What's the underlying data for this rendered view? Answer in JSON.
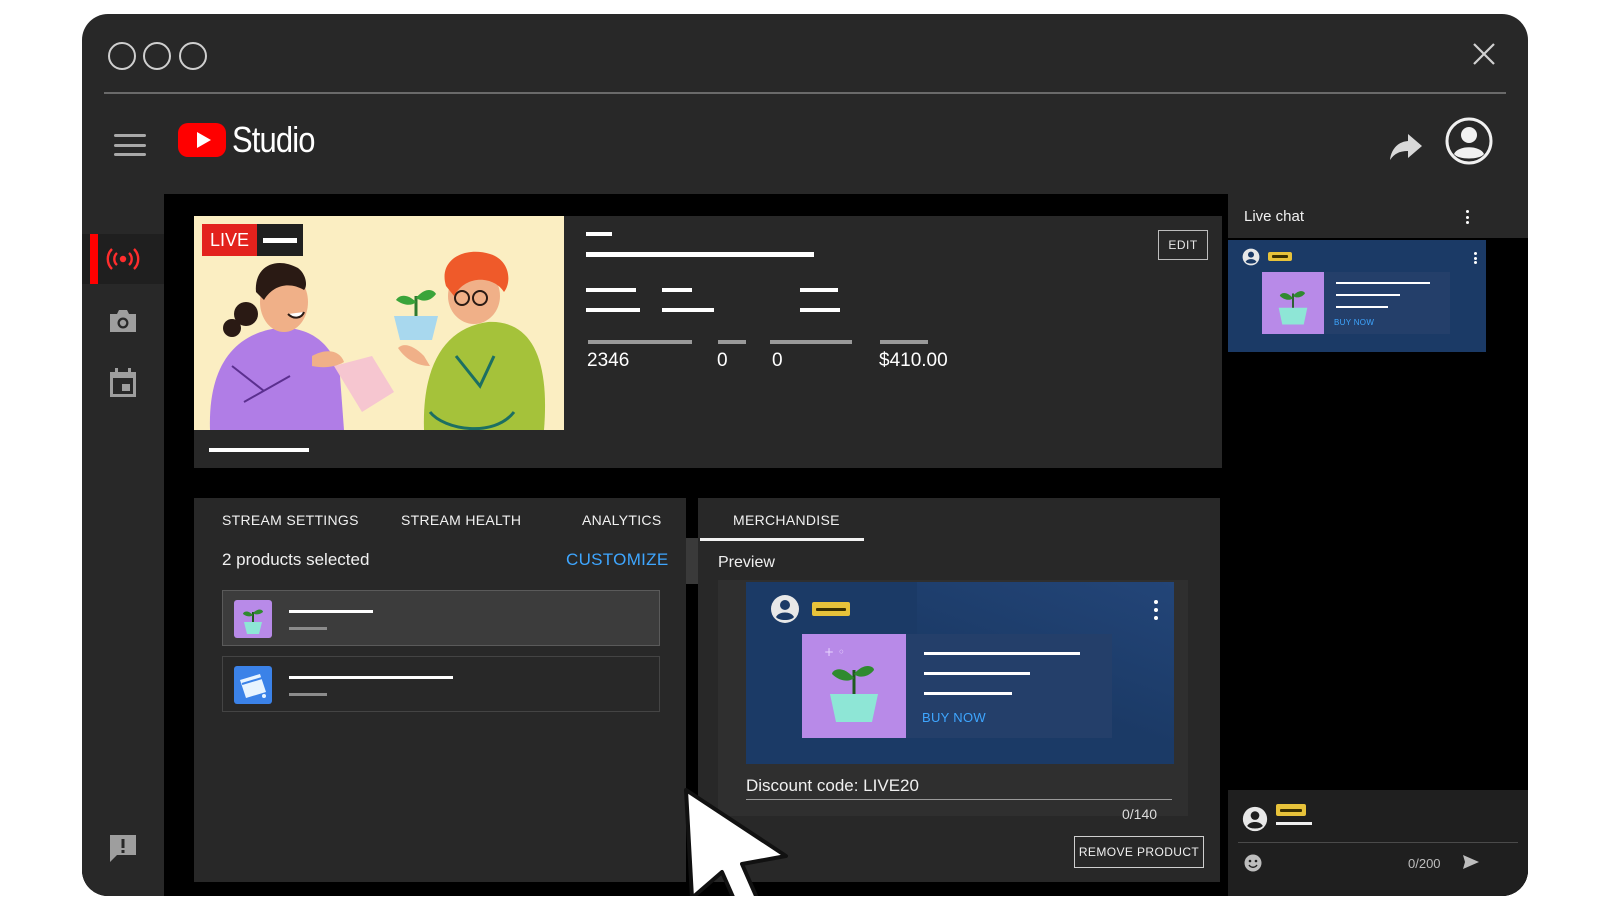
{
  "app": {
    "name": "Studio"
  },
  "stream": {
    "live_label": "LIVE",
    "edit_label": "EDIT",
    "stats": [
      "2346",
      "0",
      "0",
      "$410.00"
    ]
  },
  "tabs": [
    "STREAM SETTINGS",
    "STREAM HEALTH",
    "ANALYTICS",
    "MERCHANDISE"
  ],
  "active_tab": "MERCHANDISE",
  "merch": {
    "selected_count": "2 products selected",
    "customize_label": "CUSTOMIZE",
    "preview_label": "Preview",
    "buy_now": "BUY NOW",
    "discount_text": "Discount code: LIVE20",
    "discount_counter": "0/140",
    "remove_label": "REMOVE PRODUCT"
  },
  "chat": {
    "title": "Live chat",
    "buy_now": "BUY NOW",
    "counter": "0/200"
  },
  "colors": {
    "accent_red": "#ff0000",
    "link_blue": "#3ea6ff",
    "card_blue": "#1b3a66",
    "product_purple": "#b88ae8",
    "badge_yellow": "#e7c23a"
  },
  "icons": [
    "hamburger-icon",
    "youtube-logo-icon",
    "share-icon",
    "account-icon",
    "live-broadcast-icon",
    "camera-icon",
    "calendar-icon",
    "feedback-icon",
    "kebab-icon",
    "emoji-icon",
    "send-icon",
    "close-icon"
  ]
}
